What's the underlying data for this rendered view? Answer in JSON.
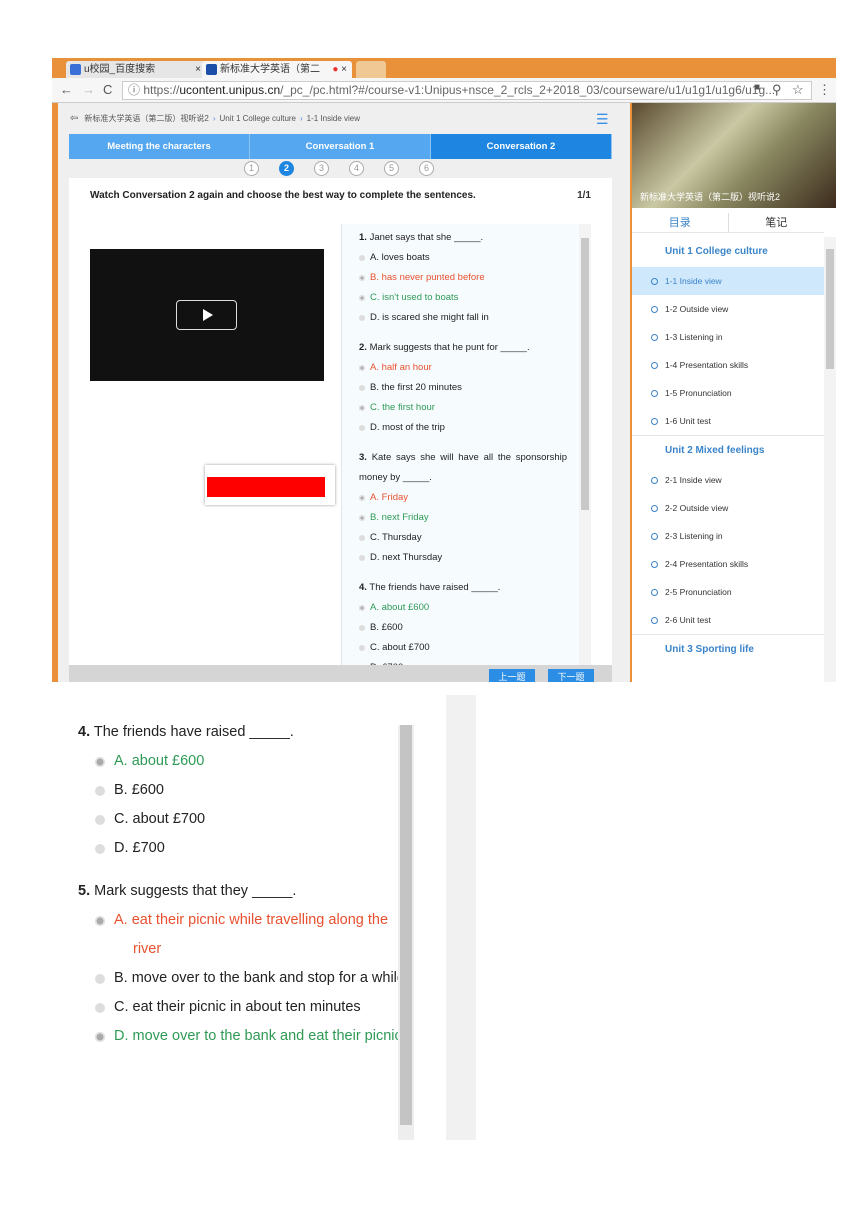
{
  "browser": {
    "tabs": [
      {
        "label": "u校园_百度搜索"
      },
      {
        "label": "新标准大学英语（第二"
      }
    ],
    "url_prefix": "https://",
    "url_host": "ucontent.unipus.cn",
    "url_rest": "/_pc_/pc.html?#/course-v1:Unipus+nsce_2_rcls_2+2018_03/courseware/u1/u1g1/u1g6/u1g..."
  },
  "breadcrumb": [
    "新标准大学英语（第二版）视听说2",
    "Unit 1 College culture",
    "1-1 Inside view"
  ],
  "section_tabs": [
    {
      "label": "Meeting the characters"
    },
    {
      "label": "Conversation 1"
    },
    {
      "label": "Conversation 2",
      "active": true
    }
  ],
  "steps": [
    "1",
    "2",
    "3",
    "4",
    "5",
    "6"
  ],
  "active_step": 2,
  "instruction": "Watch Conversation 2 again and choose the best way to complete the sentences.",
  "page_count": "1/1",
  "colors": {
    "accent": "#1e86e0",
    "wrong": "#e8512f",
    "correct": "#2f9a55",
    "browser_frame": "#e8913a"
  },
  "questions": [
    {
      "num": "1.",
      "text": "Janet says that she _____.",
      "options": [
        {
          "t": "A. loves boats"
        },
        {
          "t": "B. has never punted before",
          "state": "wrong"
        },
        {
          "t": "C. isn't used to boats",
          "state": "correct"
        },
        {
          "t": "D. is scared she might fall in"
        }
      ]
    },
    {
      "num": "2.",
      "text": "Mark suggests that he punt for _____.",
      "options": [
        {
          "t": "A. half an hour",
          "state": "wrong"
        },
        {
          "t": "B. the first 20 minutes"
        },
        {
          "t": "C. the first hour",
          "state": "correct"
        },
        {
          "t": "D. most of the trip"
        }
      ]
    },
    {
      "num": "3.",
      "text": "Kate says she will have all the sponsorship money by _____.",
      "options": [
        {
          "t": "A. Friday",
          "state": "wrong"
        },
        {
          "t": "B. next Friday",
          "state": "correct"
        },
        {
          "t": "C. Thursday"
        },
        {
          "t": "D. next Thursday"
        }
      ]
    },
    {
      "num": "4.",
      "text": "The friends have raised _____.",
      "options": [
        {
          "t": "A. about £600",
          "state": "correct"
        },
        {
          "t": "B. £600"
        },
        {
          "t": "C. about £700"
        },
        {
          "t": "D. £700"
        }
      ]
    },
    {
      "num": "5.",
      "text": "Mark suggests that they _____.",
      "options": [
        {
          "t": "A. eat their picnic while travelling along the river",
          "state": "wrong"
        },
        {
          "t": "B. move over to the bank and stop for a while"
        },
        {
          "t": "C. eat their picnic in about ten minutes"
        },
        {
          "t": "D. move over to the bank and eat their picnic",
          "state": "correct"
        }
      ]
    }
  ],
  "buttons": {
    "prev": "上一题",
    "next": "下一题"
  },
  "sidebar": {
    "course_title": "新标准大学英语（第二版）视听说2",
    "tabs": [
      "目录",
      "笔记"
    ],
    "units": [
      {
        "title": "Unit 1 College culture",
        "items": [
          "1-1 Inside view",
          "1-2 Outside view",
          "1-3 Listening in",
          "1-4 Presentation skills",
          "1-5 Pronunciation",
          "1-6 Unit test"
        ]
      },
      {
        "title": "Unit 2 Mixed feelings",
        "items": [
          "2-1 Inside view",
          "2-2 Outside view",
          "2-3 Listening in",
          "2-4 Presentation skills",
          "2-5 Pronunciation",
          "2-6 Unit test"
        ]
      },
      {
        "title": "Unit 3 Sporting life",
        "items": []
      }
    ]
  }
}
